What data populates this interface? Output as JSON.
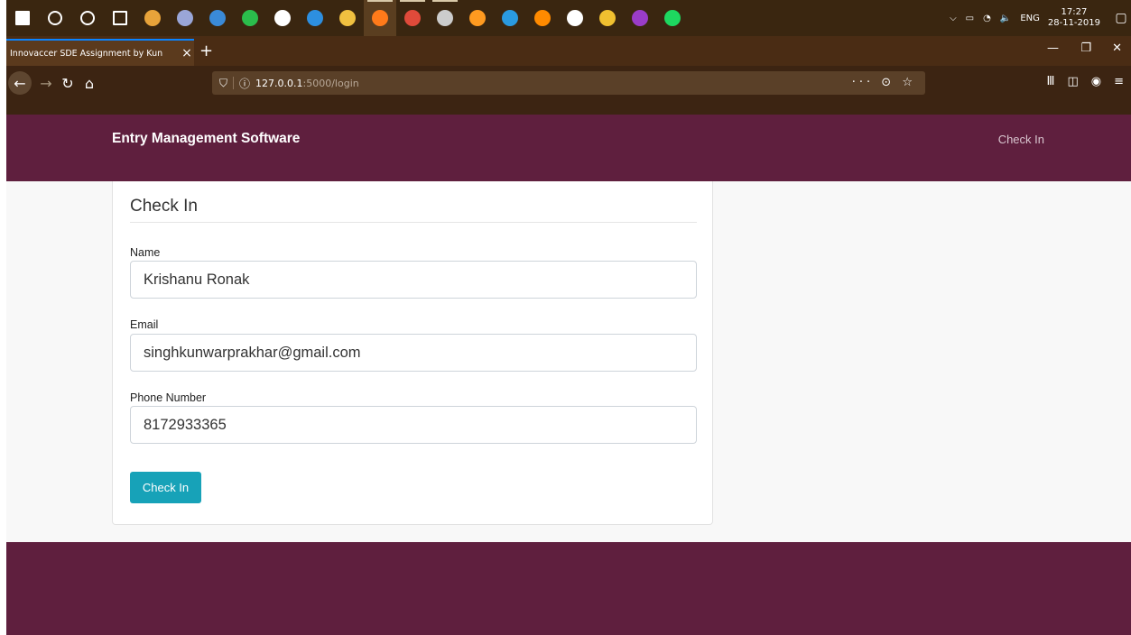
{
  "taskbar": {
    "icons": [
      {
        "name": "windows-start-icon",
        "color": "#ffffff"
      },
      {
        "name": "search-icon",
        "color": "#ffffff"
      },
      {
        "name": "cortana-icon",
        "color": "#ffffff"
      },
      {
        "name": "task-view-icon",
        "color": "#ffffff"
      },
      {
        "name": "app-icon",
        "color": "#e8a33a"
      },
      {
        "name": "eclipse-icon",
        "color": "#9aa6d8"
      },
      {
        "name": "media-player-icon",
        "color": "#3a8ad8"
      },
      {
        "name": "whatsapp-icon",
        "color": "#2bbd4c"
      },
      {
        "name": "app-icon",
        "color": "#ffffff"
      },
      {
        "name": "edge-icon",
        "color": "#2d8fe0"
      },
      {
        "name": "file-explorer-icon",
        "color": "#f0c040"
      },
      {
        "name": "firefox-icon",
        "color": "#ff7a1a"
      },
      {
        "name": "chrome-icon",
        "color": "#e04a3a"
      },
      {
        "name": "terminal-icon",
        "color": "#cccccc"
      },
      {
        "name": "sublime-icon",
        "color": "#ff9a20"
      },
      {
        "name": "vscode-icon",
        "color": "#2a9ae0"
      },
      {
        "name": "vlc-icon",
        "color": "#ff8a00"
      },
      {
        "name": "mail-icon",
        "color": "#ffffff"
      },
      {
        "name": "star-app-icon",
        "color": "#f0c030"
      },
      {
        "name": "onenote-icon",
        "color": "#9a3cc8"
      },
      {
        "name": "spotify-icon",
        "color": "#1ed760"
      }
    ],
    "tray_icons": [
      "⌵",
      "▭",
      "◔",
      "🔈"
    ],
    "language": "ENG",
    "time": "17:27",
    "date": "28-11-2019"
  },
  "browser": {
    "tab_title": "Innovaccer SDE Assignment by Kun",
    "tab_close": "×",
    "new_tab": "+",
    "url_host": "127.0.0.1",
    "url_path": ":5000/login",
    "url_actions": "··· ⊙ ☆"
  },
  "app": {
    "brand": "Entry Management Software",
    "nav_checkin": "Check In"
  },
  "form": {
    "title": "Check In",
    "name_label": "Name",
    "name_value": "Krishanu Ronak",
    "email_label": "Email",
    "email_value": "singhkunwarprakhar@gmail.com",
    "phone_label": "Phone Number",
    "phone_value": "8172933365",
    "submit_label": "Check In"
  },
  "colors": {
    "header": "#5f1f3e",
    "button": "#17a2b8"
  }
}
